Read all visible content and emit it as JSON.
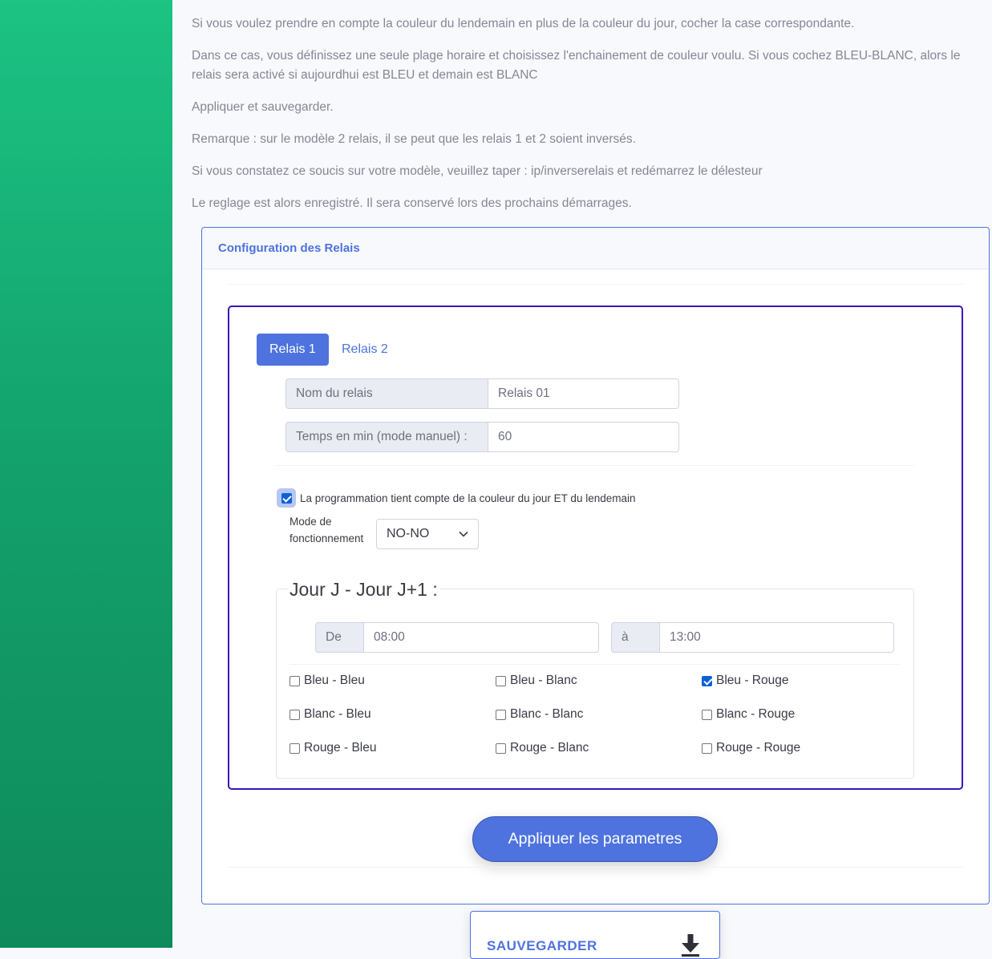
{
  "paragraphs": [
    "Si vous voulez prendre en compte la couleur du lendemain en plus de la couleur du jour, cocher la case correspondante.",
    "Dans ce cas, vous définissez une seule plage horaire et choisissez l'enchainement de couleur voulu. Si vous cochez BLEU-BLANC, alors le relais sera activé si aujourdhui est BLEU et demain est BLANC",
    "Appliquer et sauvegarder.",
    "Remarque : sur le modèle 2 relais, il se peut que les relais 1 et 2 soient inversés.",
    "Si vous constatez ce soucis sur votre modèle, veuillez taper : ip/inverserelais et redémarrez le délesteur",
    "Le reglage est alors enregistré. Il sera conservé lors des prochains démarrages."
  ],
  "card": {
    "title": "Configuration des Relais"
  },
  "tabs": [
    "Relais 1",
    "Relais 2"
  ],
  "relay": {
    "name_label": "Nom du relais",
    "name_value": "Relais 01",
    "time_label": "Temps en min (mode manuel) :",
    "time_value": "60",
    "tomorrow_label": "La programmation tient compte de la couleur du jour ET du lendemain",
    "tomorrow_checked": true,
    "mode_label_1": "Mode de",
    "mode_label_2": "fonctionnement",
    "mode_value": "NO-NO"
  },
  "schedule": {
    "legend": "Jour J - Jour J+1 :",
    "from_label": "De",
    "from_value": "08:00",
    "to_label": "à",
    "to_value": "13:00",
    "combinations": [
      {
        "label": "Bleu - Bleu",
        "checked": false
      },
      {
        "label": "Bleu - Blanc",
        "checked": false
      },
      {
        "label": "Bleu - Rouge",
        "checked": true
      },
      {
        "label": "Blanc - Bleu",
        "checked": false
      },
      {
        "label": "Blanc - Blanc",
        "checked": false
      },
      {
        "label": "Blanc - Rouge",
        "checked": false
      },
      {
        "label": "Rouge - Bleu",
        "checked": false
      },
      {
        "label": "Rouge - Blanc",
        "checked": false
      },
      {
        "label": "Rouge - Rouge",
        "checked": false
      }
    ]
  },
  "apply_label": "Appliquer les parametres",
  "save_label": "SAUVEGARDER",
  "icons": {
    "dropdown": "chevron-down-icon",
    "save": "download-icon"
  },
  "colors": {
    "primary": "#4e73df",
    "sidebar": "#1cc383",
    "frame": "#3a16b8"
  }
}
